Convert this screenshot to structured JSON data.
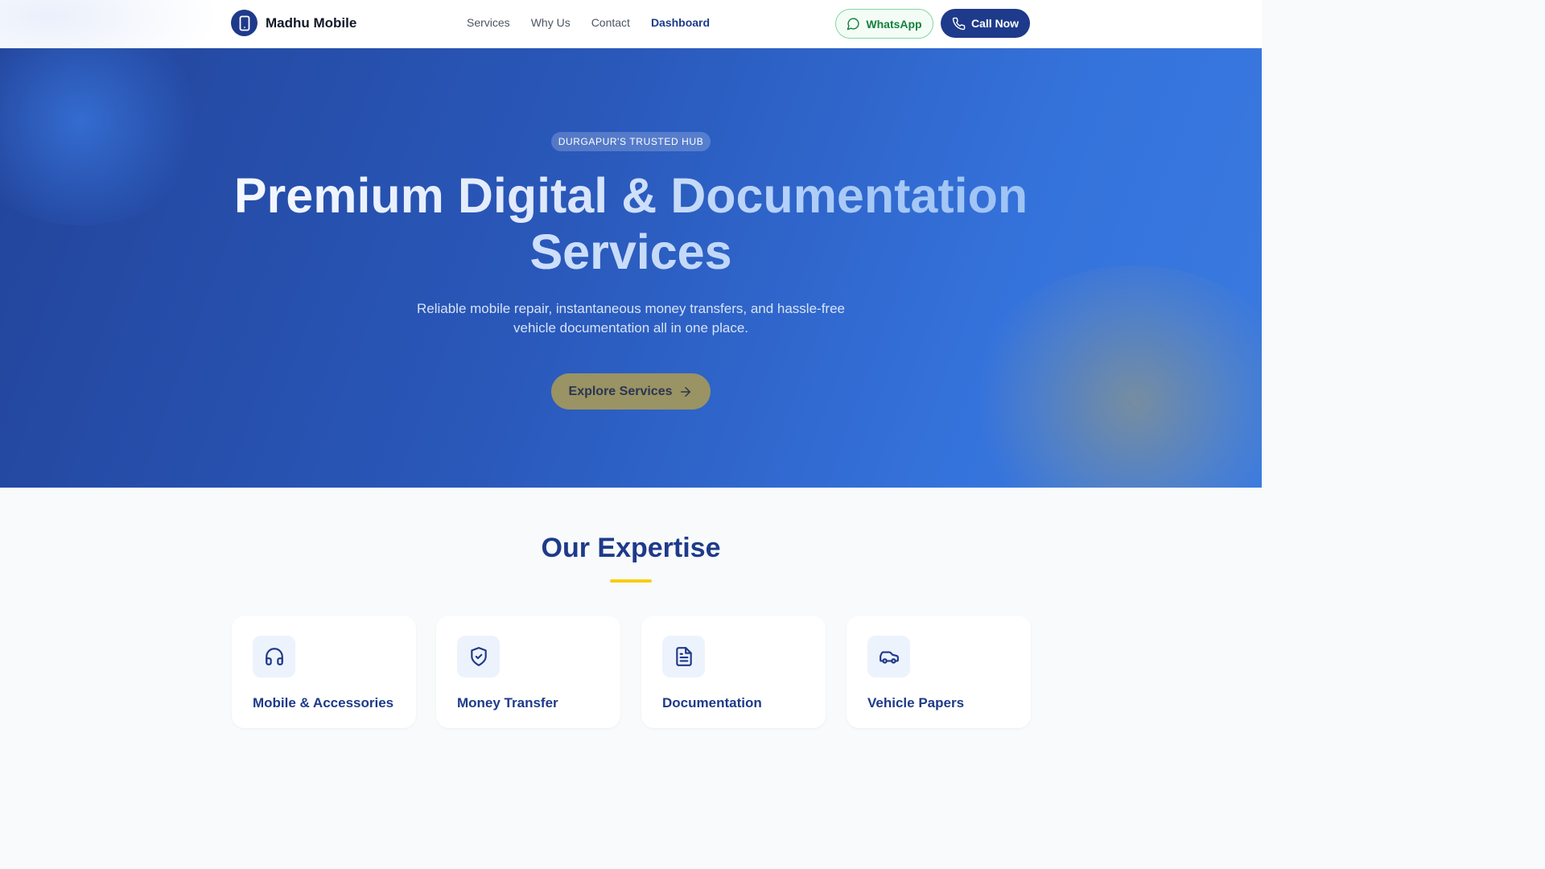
{
  "header": {
    "brand_name": "Madhu Mobile",
    "nav": [
      "Services",
      "Why Us",
      "Contact",
      "Dashboard"
    ],
    "active_nav": "Dashboard",
    "whatsapp_label": "WhatsApp",
    "call_label": "Call Now"
  },
  "hero": {
    "badge": "DURGAPUR'S TRUSTED HUB",
    "title_line1": "Premium Digital & Documentation",
    "title_line2": "Services",
    "subtitle": "Reliable mobile repair, instantaneous money transfers, and hassle-free vehicle documentation all in one place.",
    "cta_label": "Explore Services"
  },
  "expertise": {
    "title": "Our Expertise",
    "cards": [
      {
        "title": "Mobile & Accessories",
        "icon": "headphones-icon"
      },
      {
        "title": "Money Transfer",
        "icon": "shield-check-icon"
      },
      {
        "title": "Documentation",
        "icon": "document-icon"
      },
      {
        "title": "Vehicle Papers",
        "icon": "car-icon"
      }
    ]
  },
  "colors": {
    "primary": "#1e3a8a",
    "accent_yellow": "#facc15",
    "whatsapp_green": "#15803d",
    "hero_gradient_start": "#22449a",
    "hero_gradient_end": "#3a7ae0"
  }
}
